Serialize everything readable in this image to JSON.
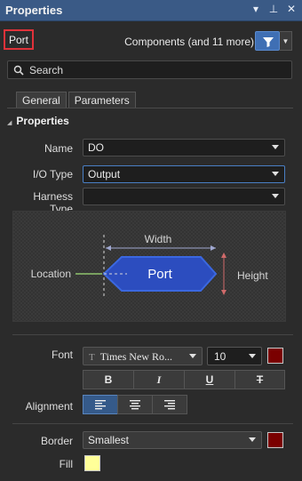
{
  "panel": {
    "title": "Properties",
    "controls": {
      "menu": "▾",
      "pin": "⊥",
      "close": "✕"
    }
  },
  "header": {
    "object_type": "Port",
    "components_label": "Components (and 11 more)"
  },
  "search": {
    "placeholder": "Search"
  },
  "tabs": [
    {
      "label": "General",
      "active": true
    },
    {
      "label": "Parameters",
      "active": false
    }
  ],
  "section": {
    "title": "Properties"
  },
  "fields": {
    "name": {
      "label": "Name",
      "value": "DO"
    },
    "io_type": {
      "label": "I/O Type",
      "value": "Output"
    },
    "harness_type": {
      "label": "Harness Type",
      "value": ""
    }
  },
  "preview": {
    "width_label": "Width",
    "height_label": "Height",
    "location_label": "Location",
    "port_label": "Port",
    "colors": {
      "port_fill": "#2c4dbf",
      "port_border": "#3b68e0",
      "location_line": "#8fc56e",
      "height_arrow": "#d06a6a",
      "width_arrow": "#a0a8d0"
    }
  },
  "font": {
    "label": "Font",
    "family": "Times New Ro...",
    "size": "10",
    "color": "#7a0000",
    "styles": {
      "bold": "B",
      "italic": "I",
      "underline": "U",
      "strike": "T"
    }
  },
  "alignment": {
    "label": "Alignment",
    "options": [
      "left",
      "center",
      "right"
    ],
    "selected": "left"
  },
  "border": {
    "label": "Border",
    "value": "Smallest",
    "color": "#7a0000"
  },
  "fill": {
    "label": "Fill",
    "color": "#ffff99"
  }
}
